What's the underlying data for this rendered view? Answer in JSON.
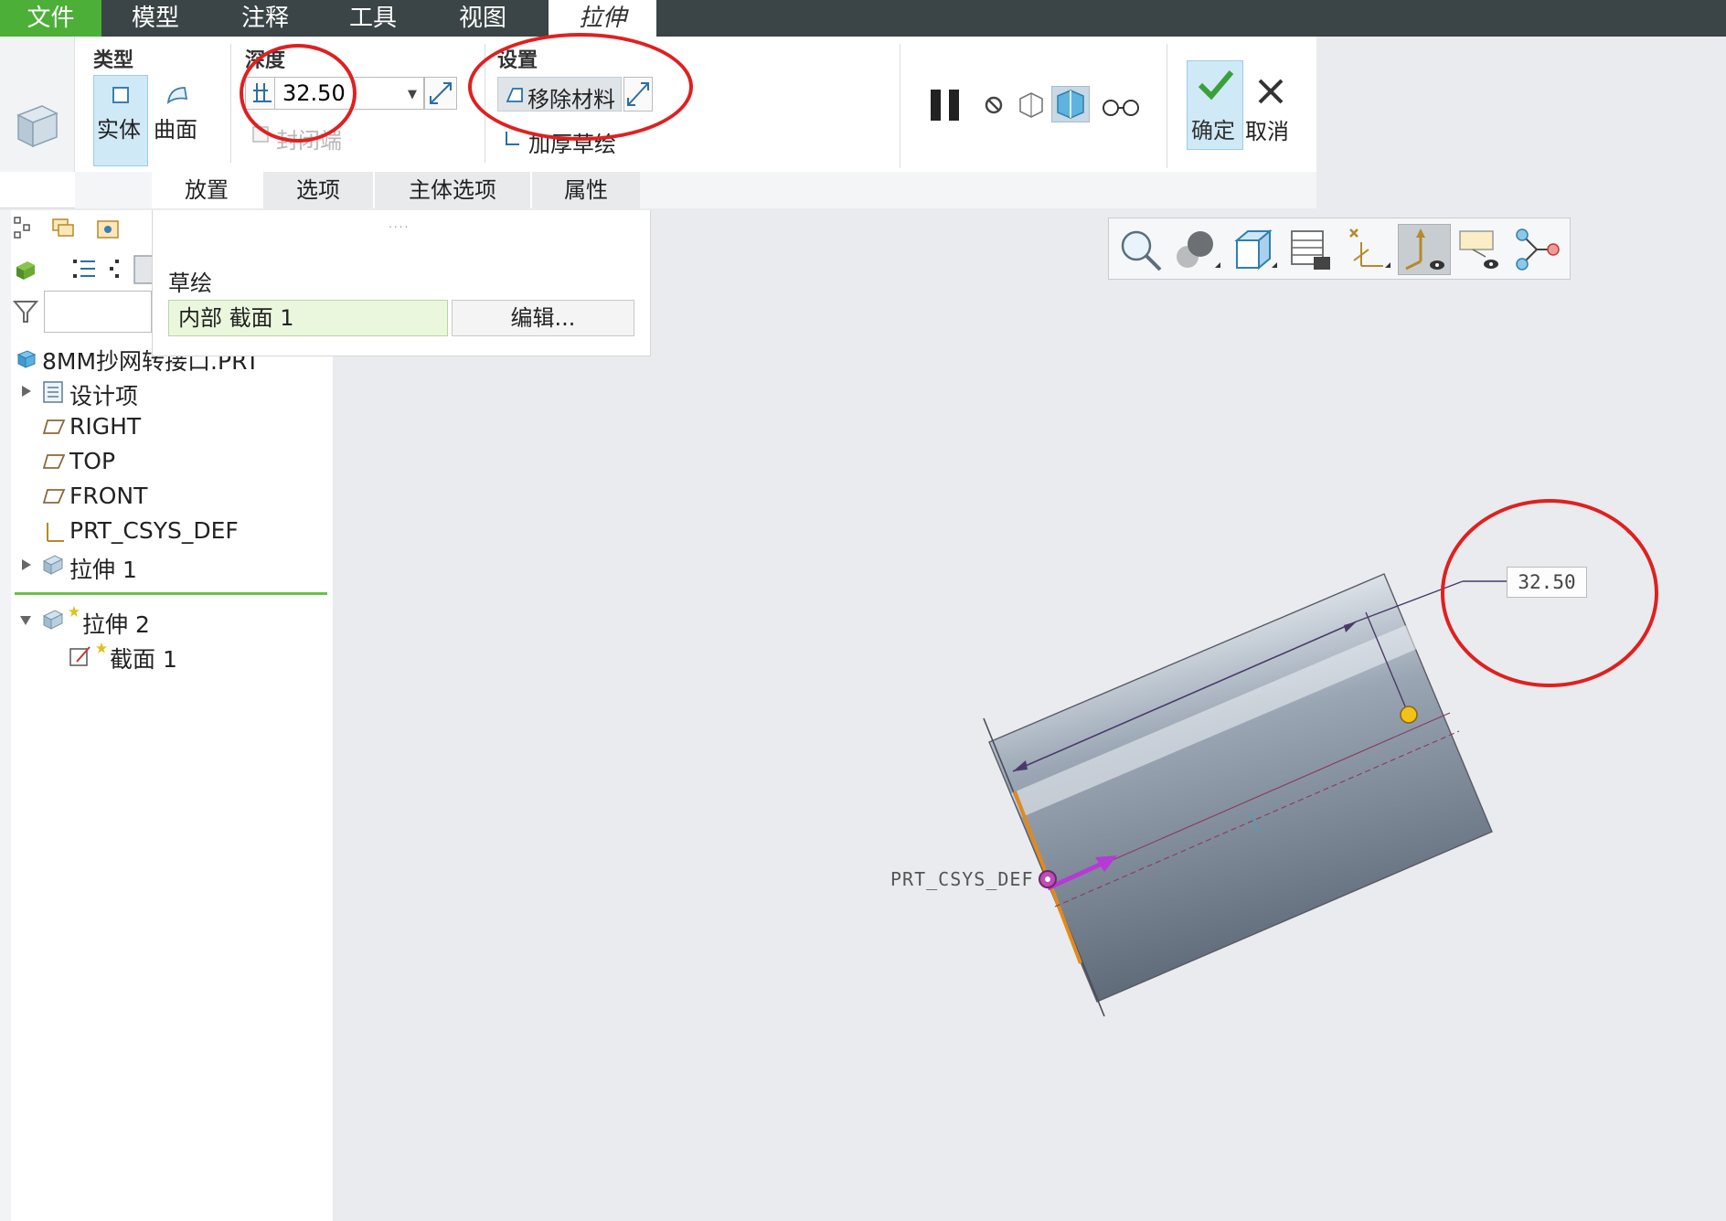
{
  "menu": {
    "file": "文件",
    "model": "模型",
    "annotate": "注释",
    "tools": "工具",
    "view": "视图",
    "extrude": "拉伸"
  },
  "ribbon": {
    "type_group": "类型",
    "solid": "实体",
    "surface": "曲面",
    "depth_group": "深度",
    "depth_value": "32.50",
    "capped_ends": "封闭端",
    "settings_group": "设置",
    "remove_material": "移除材料",
    "thicken_sketch": "加厚草绘",
    "ok": "确定",
    "cancel": "取消"
  },
  "subtabs": [
    "放置",
    "选项",
    "主体选项",
    "属性"
  ],
  "placement_panel": {
    "sketch_label": "草绘",
    "section_value": "内部 截面 1",
    "edit_button": "编辑..."
  },
  "model_tree": {
    "root": "8MM抄网转接口.PRT",
    "items": [
      "设计项",
      "RIGHT",
      "TOP",
      "FRONT",
      "PRT_CSYS_DEF",
      "拉伸 1",
      "拉伸 2",
      "截面 1"
    ]
  },
  "viewport": {
    "dimension_value": "32.50",
    "csys_label": "PRT_CSYS_DEF"
  },
  "colors": {
    "file_tab": "#4caf37",
    "menubar": "#3b4446",
    "highlight": "#cfe9f7",
    "annotation_ring": "#e02020"
  }
}
